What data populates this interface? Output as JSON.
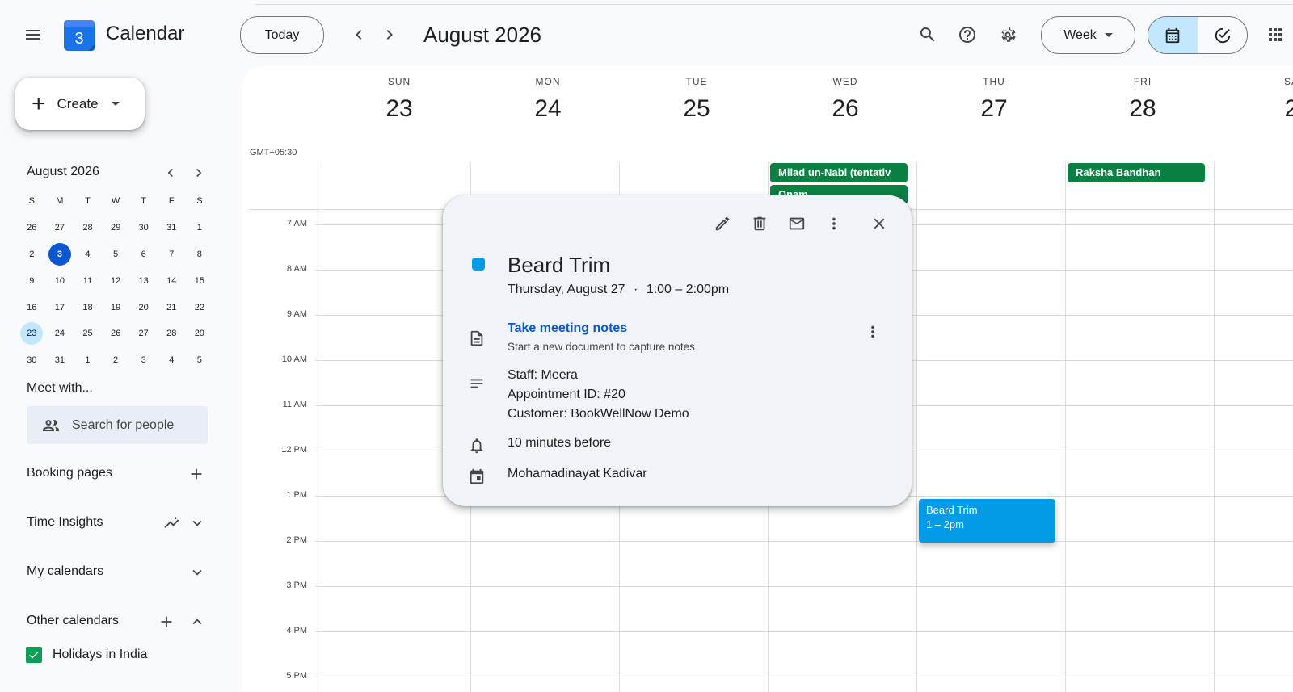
{
  "header": {
    "app_title": "Calendar",
    "logo_day": "3",
    "today_label": "Today",
    "date_title": "August 2026",
    "view_label": "Week"
  },
  "sidebar": {
    "create_label": "Create",
    "mini_month_title": "August 2026",
    "mini_day_headers": [
      "S",
      "M",
      "T",
      "W",
      "T",
      "F",
      "S"
    ],
    "mini_weeks": [
      [
        "26",
        "27",
        "28",
        "29",
        "30",
        "31",
        "1"
      ],
      [
        "2",
        "3",
        "4",
        "5",
        "6",
        "7",
        "8"
      ],
      [
        "9",
        "10",
        "11",
        "12",
        "13",
        "14",
        "15"
      ],
      [
        "16",
        "17",
        "18",
        "19",
        "20",
        "21",
        "22"
      ],
      [
        "23",
        "24",
        "25",
        "26",
        "27",
        "28",
        "29"
      ],
      [
        "30",
        "31",
        "1",
        "2",
        "3",
        "4",
        "5"
      ]
    ],
    "meet_with_label": "Meet with...",
    "search_people_placeholder": "Search for people",
    "booking_pages_label": "Booking pages",
    "time_insights_label": "Time Insights",
    "my_calendars_label": "My calendars",
    "other_calendars_label": "Other calendars",
    "holidays_label": "Holidays in India",
    "holidays_checked": true
  },
  "week": {
    "timezone": "GMT+05:30",
    "days": [
      {
        "name": "SUN",
        "date": "23"
      },
      {
        "name": "MON",
        "date": "24"
      },
      {
        "name": "TUE",
        "date": "25"
      },
      {
        "name": "WED",
        "date": "26"
      },
      {
        "name": "THU",
        "date": "27"
      },
      {
        "name": "FRI",
        "date": "28"
      },
      {
        "name": "SA",
        "date": "2"
      }
    ],
    "hours": [
      "7 AM",
      "8 AM",
      "9 AM",
      "10 AM",
      "11 AM",
      "12 PM",
      "1 PM",
      "2 PM",
      "3 PM",
      "4 PM",
      "5 PM"
    ],
    "allday_events": [
      {
        "title": "Milad un-Nabi (tentativ",
        "color": "#0b8043"
      },
      {
        "title": "Onam",
        "color": "#0b8043"
      },
      {
        "title": "Raksha Bandhan",
        "color": "#0b8043"
      }
    ],
    "timed_event": {
      "title": "Beard Trim",
      "time": "1 – 2pm",
      "color": "#039be5"
    }
  },
  "popup": {
    "title": "Beard Trim",
    "when_date": "Thursday, August 27",
    "when_sep": "·",
    "when_time": "1:00 – 2:00pm",
    "notes_link": "Take meeting notes",
    "notes_sub": "Start a new document to capture notes",
    "description_lines": [
      "Staff: Meera",
      "Appointment ID: #20",
      "Customer: BookWellNow Demo"
    ],
    "reminder": "10 minutes before",
    "calendar_owner": "Mohamadinayat Kadivar",
    "event_color": "#039be5"
  },
  "colors": {
    "accent": "#0b57d0",
    "selected_view": "#c2e7ff",
    "holiday_green": "#0b8043"
  }
}
